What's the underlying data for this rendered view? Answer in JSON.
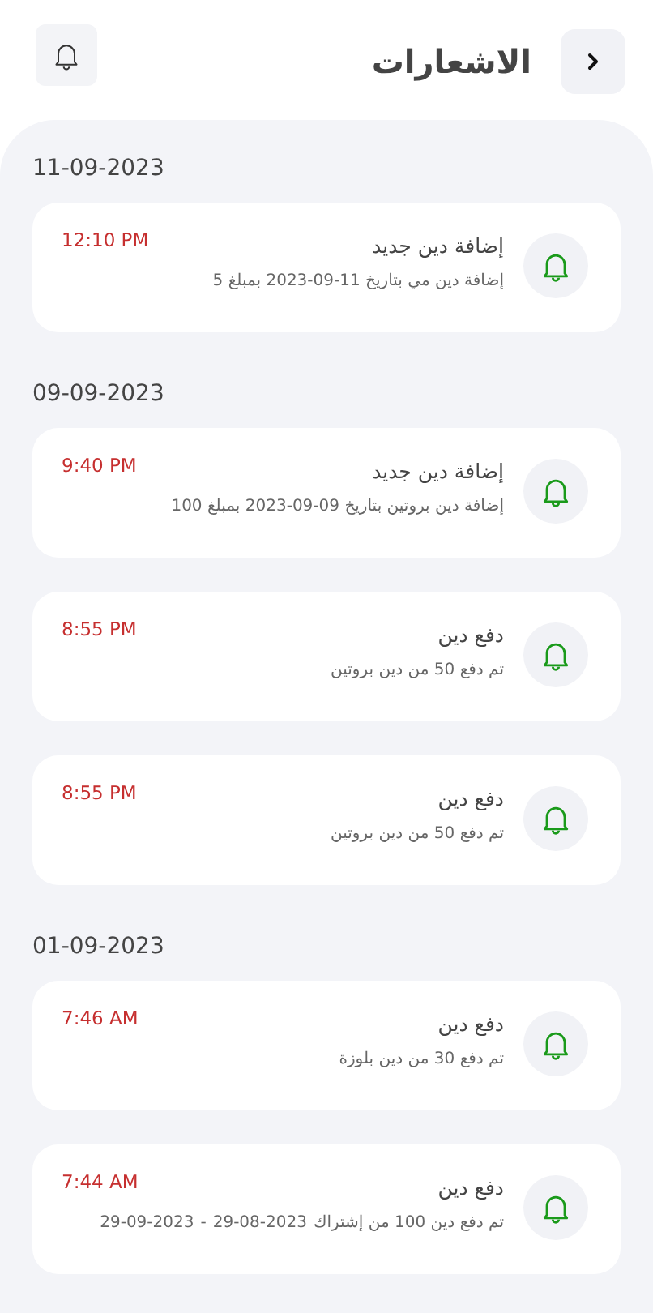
{
  "header": {
    "title": "الاشعارات"
  },
  "groups": [
    {
      "date": "11-09-2023",
      "items": [
        {
          "title": "إضافة دين جديد",
          "message": "إضافة دين مي بتاريخ 11-09-2023 بمبلغ 5",
          "time": "12:10 PM"
        }
      ]
    },
    {
      "date": "09-09-2023",
      "items": [
        {
          "title": "إضافة دين جديد",
          "message": "إضافة دين بروتين بتاريخ 09-09-2023 بمبلغ 100",
          "time": "9:40 PM"
        },
        {
          "title": "دفع دين",
          "message": "تم دفع  50  من دين بروتين",
          "time": "8:55 PM"
        },
        {
          "title": "دفع دين",
          "message": "تم دفع  50  من دين بروتين",
          "time": "8:55 PM"
        }
      ]
    },
    {
      "date": "01-09-2023",
      "items": [
        {
          "title": "دفع دين",
          "message": "تم دفع  30  من دين بلوزة",
          "time": "7:46 AM"
        },
        {
          "title": "دفع دين",
          "message": "تم دفع دين  100 من إشتراك",
          "period": {
            "from": "29-08-2023",
            "separator": "-",
            "to": "29-09-2023"
          },
          "time": "7:44 AM"
        }
      ]
    }
  ]
}
